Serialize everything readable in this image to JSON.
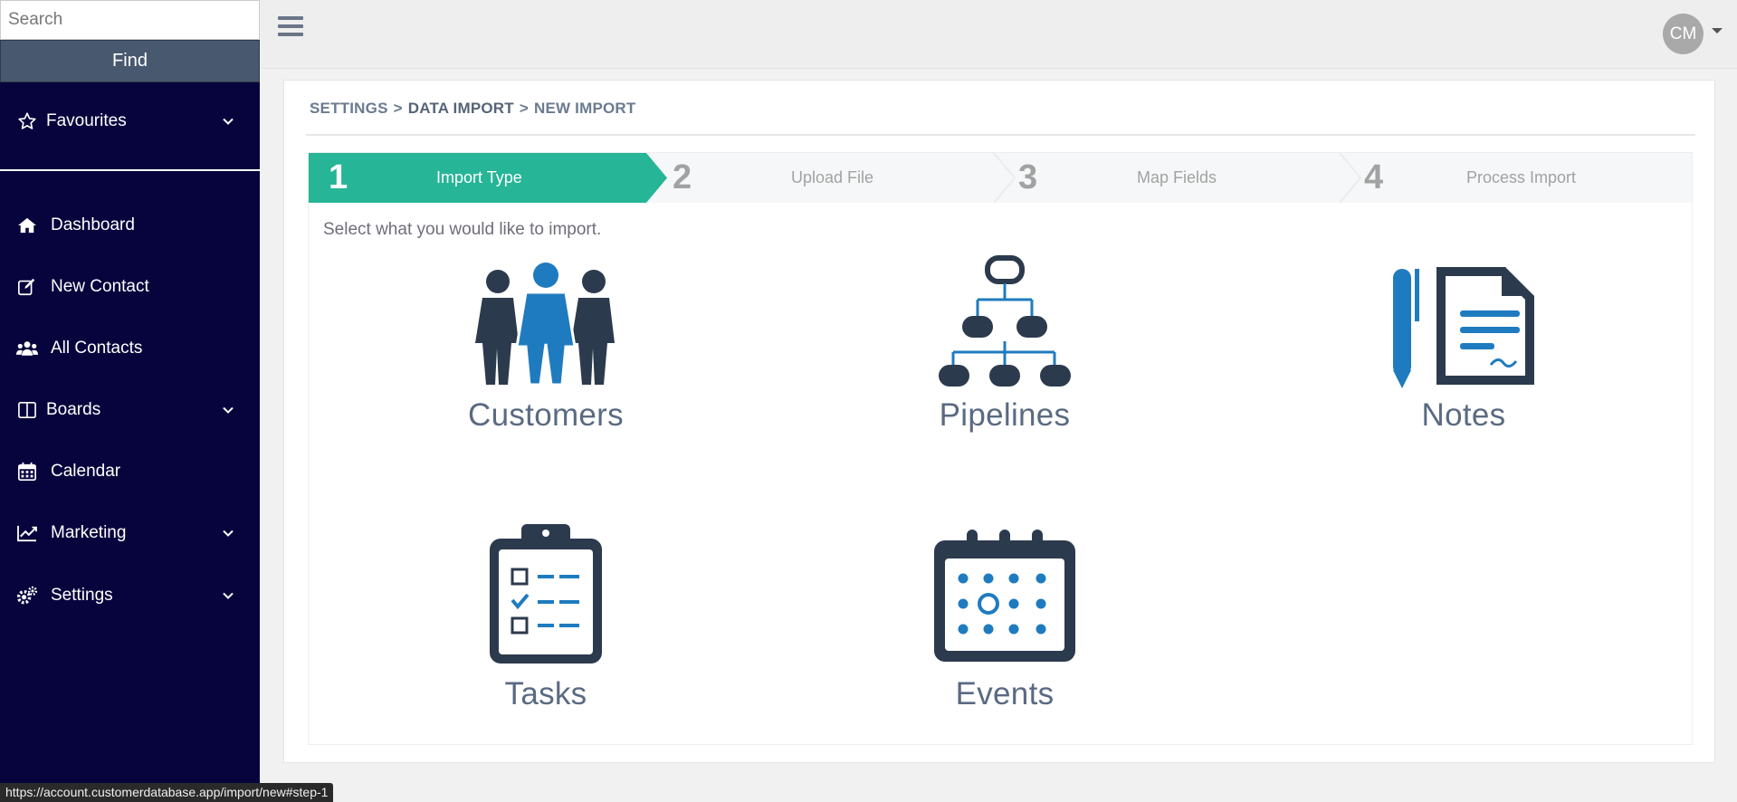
{
  "sidebar": {
    "search_placeholder": "Search",
    "find_label": "Find",
    "favourites": "Favourites",
    "items": [
      {
        "label": "Dashboard",
        "icon": "home-icon"
      },
      {
        "label": "New Contact",
        "icon": "edit-icon"
      },
      {
        "label": "All Contacts",
        "icon": "users-icon"
      },
      {
        "label": "Boards",
        "icon": "columns-icon"
      },
      {
        "label": "Calendar",
        "icon": "calendar-icon"
      },
      {
        "label": "Marketing",
        "icon": "chart-line-icon"
      },
      {
        "label": "Settings",
        "icon": "gears-icon"
      }
    ]
  },
  "header": {
    "avatar_initials": "CM"
  },
  "breadcrumb": {
    "part1": "SETTINGS",
    "sep": ">",
    "part2": "DATA IMPORT",
    "part3": "NEW IMPORT"
  },
  "wizard": {
    "steps": [
      {
        "num": "1",
        "label": "Import Type"
      },
      {
        "num": "2",
        "label": "Upload File"
      },
      {
        "num": "3",
        "label": "Map Fields"
      },
      {
        "num": "4",
        "label": "Process Import"
      }
    ],
    "prompt": "Select what you would like to import.",
    "options": [
      {
        "label": "Customers",
        "icon": "customers-icon"
      },
      {
        "label": "Pipelines",
        "icon": "pipelines-icon"
      },
      {
        "label": "Notes",
        "icon": "notes-icon"
      },
      {
        "label": "Tasks",
        "icon": "tasks-icon"
      },
      {
        "label": "Events",
        "icon": "events-icon"
      }
    ]
  },
  "colors": {
    "sidebar_bg": "#07043d",
    "active_step": "#26b596",
    "icon_dark": "#2c3a4d",
    "icon_blue": "#1f7bbf"
  },
  "statusbar": {
    "url": "https://account.customerdatabase.app/import/new#step-1"
  }
}
